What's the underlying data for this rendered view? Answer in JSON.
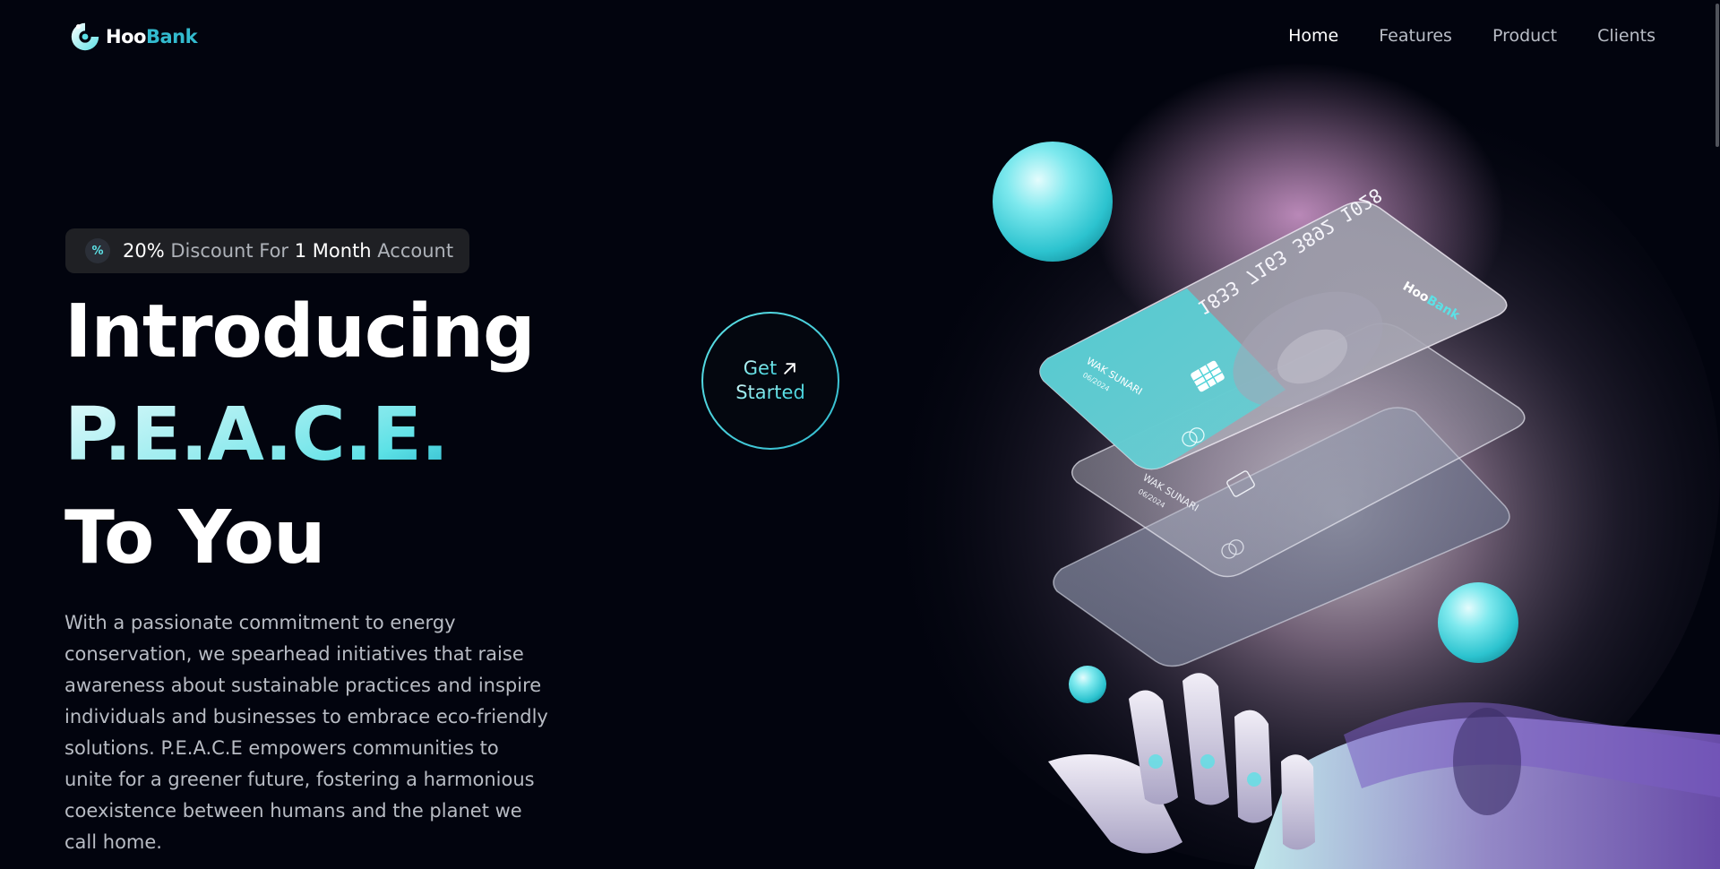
{
  "nav": {
    "logo": {
      "part1": "Hoo",
      "part2": "Bank"
    },
    "links": [
      {
        "label": "Home",
        "active": true
      },
      {
        "label": "Features",
        "active": false
      },
      {
        "label": "Product",
        "active": false
      },
      {
        "label": "Clients",
        "active": false
      }
    ]
  },
  "hero": {
    "badge": {
      "icon": "discount-icon",
      "percent": "20%",
      "text1": "Discount For",
      "duration": "1 Month",
      "text2": "Account"
    },
    "title_line1": "Introducing",
    "title_line2": "P.E.A.C.E.",
    "title_line3": "To You",
    "description": "With a passionate commitment to energy conservation, we spearhead initiatives that raise awareness about sustainable practices and inspire individuals and businesses to embrace eco-friendly solutions. P.E.A.C.E empowers communities to unite for a greener future, fostering a harmonious coexistence between humans and the planet we call home.",
    "cta": {
      "line1": "Get",
      "line2": "Started",
      "icon": "arrow-up-right-icon"
    }
  },
  "illustration": {
    "card_number": "1833 7163 3892 1028",
    "card_brand_part1": "Hoo",
    "card_brand_part2": "Bank",
    "cardholder": "WAK SUNARI",
    "expiry": "06/2024"
  },
  "colors": {
    "background": "#00040f",
    "accent": "#5ce1e6",
    "accent_dark": "#33bbcf",
    "text_dim": "#b8bcc4"
  }
}
